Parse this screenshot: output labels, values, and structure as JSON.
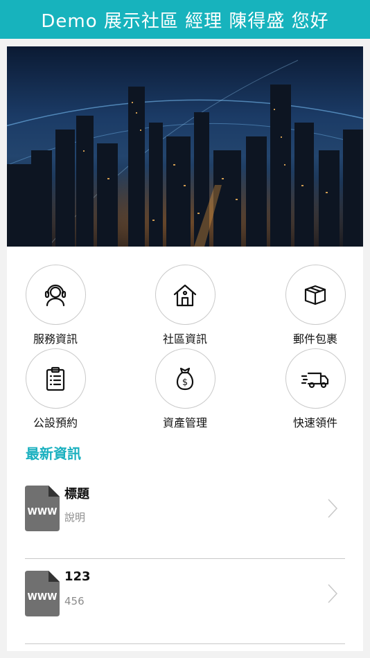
{
  "header": {
    "title": "Demo 展示社區 經理 陳得盛 您好"
  },
  "banner": {
    "alt": "city-night-banner"
  },
  "menu": [
    {
      "label": "服務資訊",
      "icon": "headset-icon"
    },
    {
      "label": "社區資訊",
      "icon": "house-icon"
    },
    {
      "label": "郵件包裹",
      "icon": "package-icon"
    },
    {
      "label": "公設預約",
      "icon": "clipboard-icon"
    },
    {
      "label": "資產管理",
      "icon": "money-bag-icon"
    },
    {
      "label": "快速領件",
      "icon": "delivery-truck-icon"
    }
  ],
  "news": {
    "section_title": "最新資訊",
    "items": [
      {
        "title": "標題",
        "description": "說明",
        "thumb_text": "WWW"
      },
      {
        "title": "123",
        "description": "456",
        "thumb_text": "WWW"
      }
    ]
  },
  "colors": {
    "accent": "#17b3bd",
    "section_title": "#1ab0bf"
  }
}
